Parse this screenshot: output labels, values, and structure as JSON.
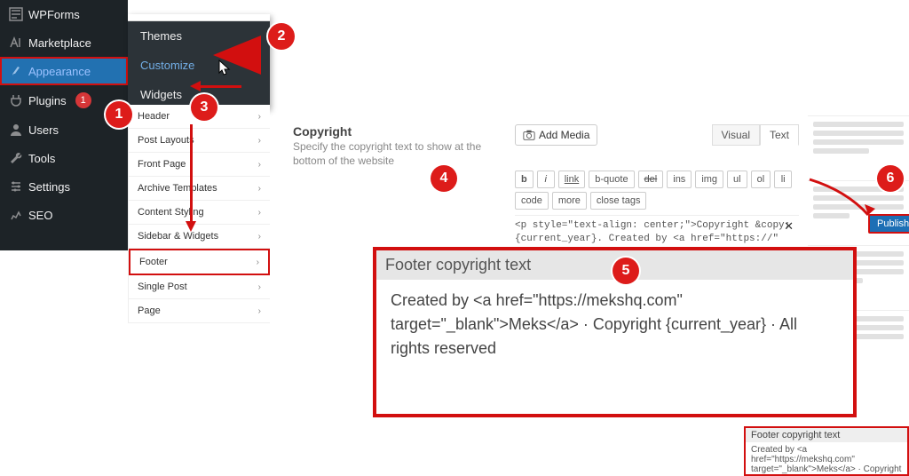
{
  "sidebar": {
    "items": [
      {
        "label": "WPForms"
      },
      {
        "label": "Marketplace"
      },
      {
        "label": "Appearance"
      },
      {
        "label": "Plugins",
        "badge": "1"
      },
      {
        "label": "Users"
      },
      {
        "label": "Tools"
      },
      {
        "label": "Settings"
      },
      {
        "label": "SEO"
      }
    ]
  },
  "flyout": {
    "items": [
      "Themes",
      "Customize",
      "Widgets"
    ]
  },
  "customizer_panel": {
    "rows": [
      "Header",
      "Post Layouts",
      "Front Page",
      "Archive Templates",
      "Content Styling",
      "Sidebar & Widgets",
      "Footer",
      "Single Post",
      "Page"
    ]
  },
  "copyright": {
    "label": "Copyright",
    "help": "Specify the copyright text to show at the bottom of the website"
  },
  "editor": {
    "add_media": "Add Media",
    "tabs": {
      "visual": "Visual",
      "text": "Text"
    },
    "tool_buttons": [
      "b",
      "i",
      "link",
      "b-quote",
      "del",
      "ins",
      "img",
      "ul",
      "ol",
      "li",
      "code",
      "more",
      "close tags"
    ],
    "content": "<p style=\"text-align: center;\">Copyright &copy; {current_year}. Created by <a href=\"https://\"  target=\"_blank\">Meks</a>. Powered by <a"
  },
  "steps": {
    "1": "1",
    "2": "2",
    "3": "3",
    "4": "4",
    "5": "5",
    "6": "6"
  },
  "publish": {
    "label": "Publish"
  },
  "footer_big": {
    "heading": "Footer copyright text",
    "body": "Created by <a href=\"https://mekshq.com\" target=\"_blank\">Meks</a> · Copyright {current_year} · All rights reserved"
  },
  "footer_small": {
    "heading": "Footer copyright text",
    "body": "Created by <a href=\"https://mekshq.com\" target=\"_blank\">Meks</a> · Copyright"
  }
}
